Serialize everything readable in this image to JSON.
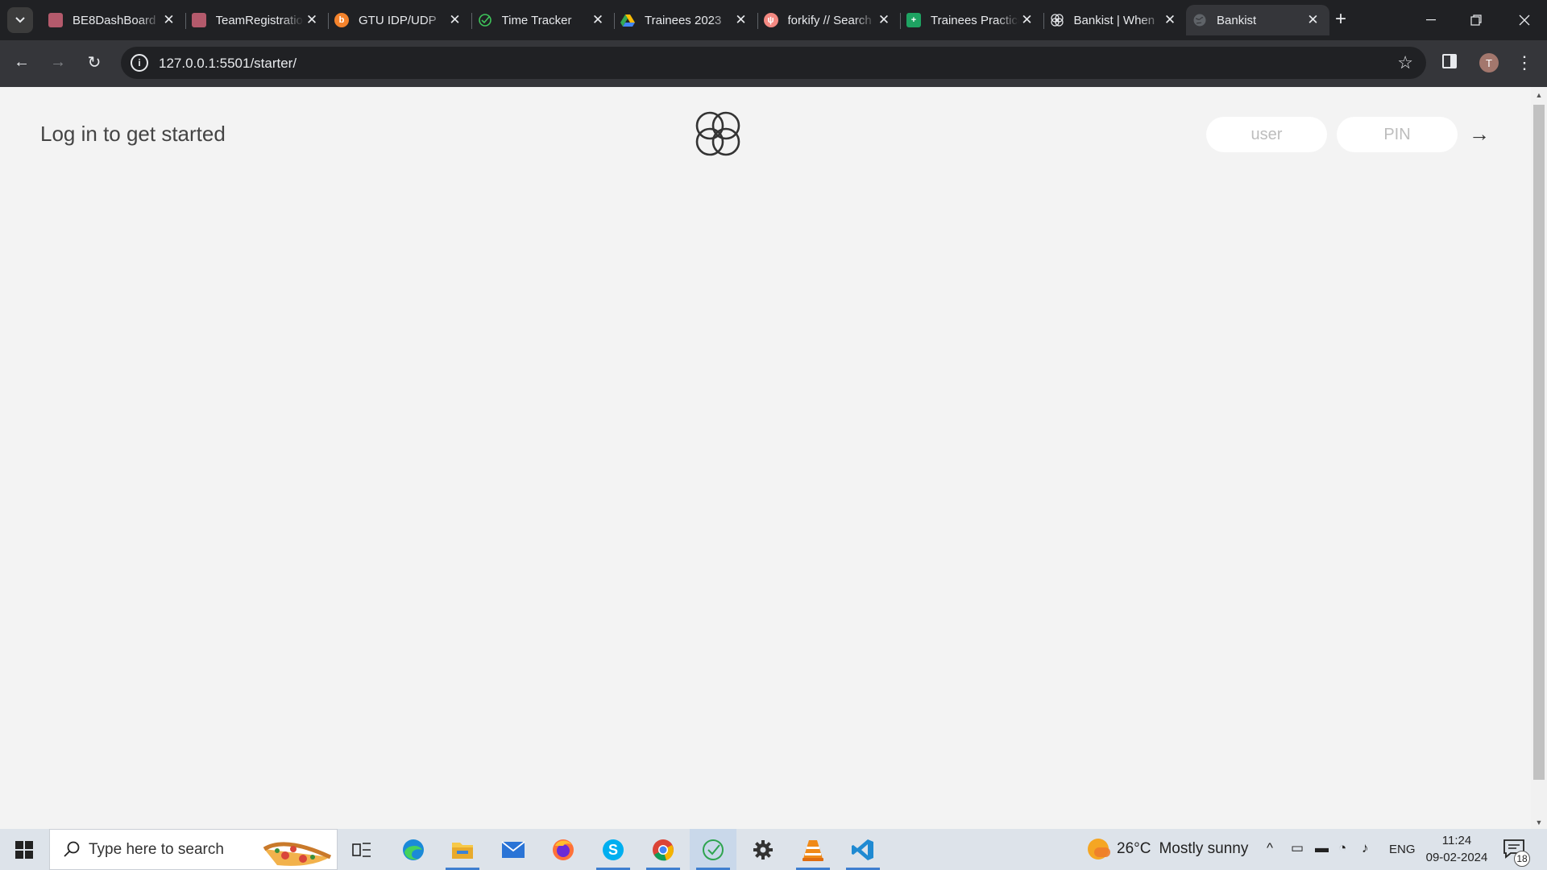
{
  "browser": {
    "tabs": [
      {
        "title": "BE8DashBoard",
        "favicon": "app-icon"
      },
      {
        "title": "TeamRegistration",
        "favicon": "app-icon"
      },
      {
        "title": "GTU IDP/UDP",
        "favicon": "b-icon"
      },
      {
        "title": "Time Tracker",
        "favicon": "clock-check-icon"
      },
      {
        "title": "Trainees 2023",
        "favicon": "drive-icon"
      },
      {
        "title": "forkify // Search",
        "favicon": "forkify-icon"
      },
      {
        "title": "Trainees Practice",
        "favicon": "sheets-icon"
      },
      {
        "title": "Bankist | When",
        "favicon": "bankist-logo-icon"
      },
      {
        "title": "Bankist",
        "favicon": "globe-icon",
        "active": true
      }
    ],
    "url": "127.0.0.1:5501/starter/",
    "profile_initial": "T"
  },
  "page": {
    "welcome": "Log in to get started",
    "user_placeholder": "user",
    "pin_placeholder": "PIN",
    "login_arrow": "→"
  },
  "taskbar": {
    "search_placeholder": "Type here to search",
    "apps": [
      "task-view",
      "edge",
      "file-explorer",
      "mail",
      "firefox",
      "skype",
      "chrome",
      "time-tracker",
      "settings",
      "vlc",
      "vscode"
    ],
    "weather": {
      "temp": "26°C",
      "condition": "Mostly sunny"
    },
    "language": "ENG",
    "time": "11:24",
    "date": "09-02-2024",
    "notifications": "18"
  },
  "colors": {
    "page_bg": "#f3f3f3",
    "tabstrip_bg": "#202124",
    "toolbar_bg": "#35363a",
    "taskbar_bg": "#dde3ea",
    "accent_running": "#3f7fd0"
  }
}
